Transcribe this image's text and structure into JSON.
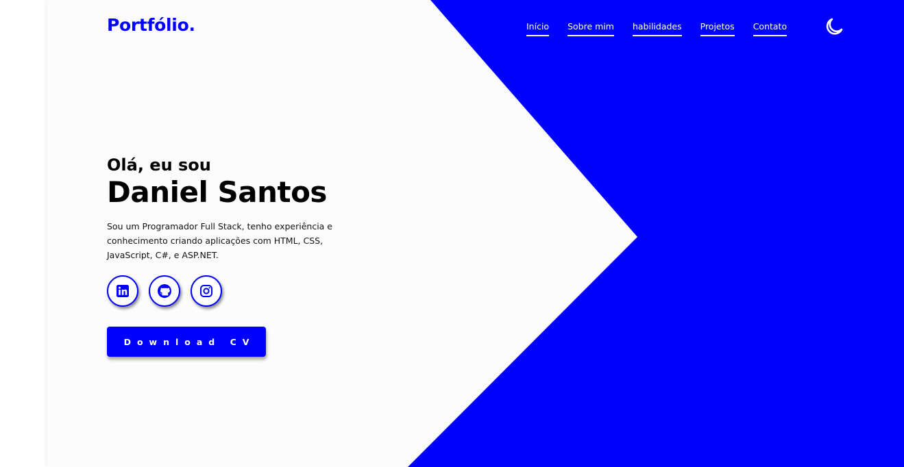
{
  "header": {
    "logo": "Portfólio."
  },
  "nav": {
    "items": [
      {
        "label": "Início"
      },
      {
        "label": "Sobre mim"
      },
      {
        "label": "habilidades"
      },
      {
        "label": "Projetos"
      },
      {
        "label": "Contato"
      }
    ],
    "theme_icon": "moon-icon"
  },
  "hero": {
    "greeting": "Olá, eu sou",
    "name": "Daniel Santos",
    "bio": "Sou um Programador Full Stack, tenho experiência e conhecimento criando aplicações com HTML, CSS, JavaScript, C#, e ASP.NET."
  },
  "socials": [
    {
      "icon": "linkedin-icon"
    },
    {
      "icon": "github-icon"
    },
    {
      "icon": "instagram-icon"
    }
  ],
  "cta": {
    "download_label": "Download CV"
  },
  "colors": {
    "accent": "#0000ff",
    "background": "#fcfcfc",
    "text": "#000000"
  }
}
